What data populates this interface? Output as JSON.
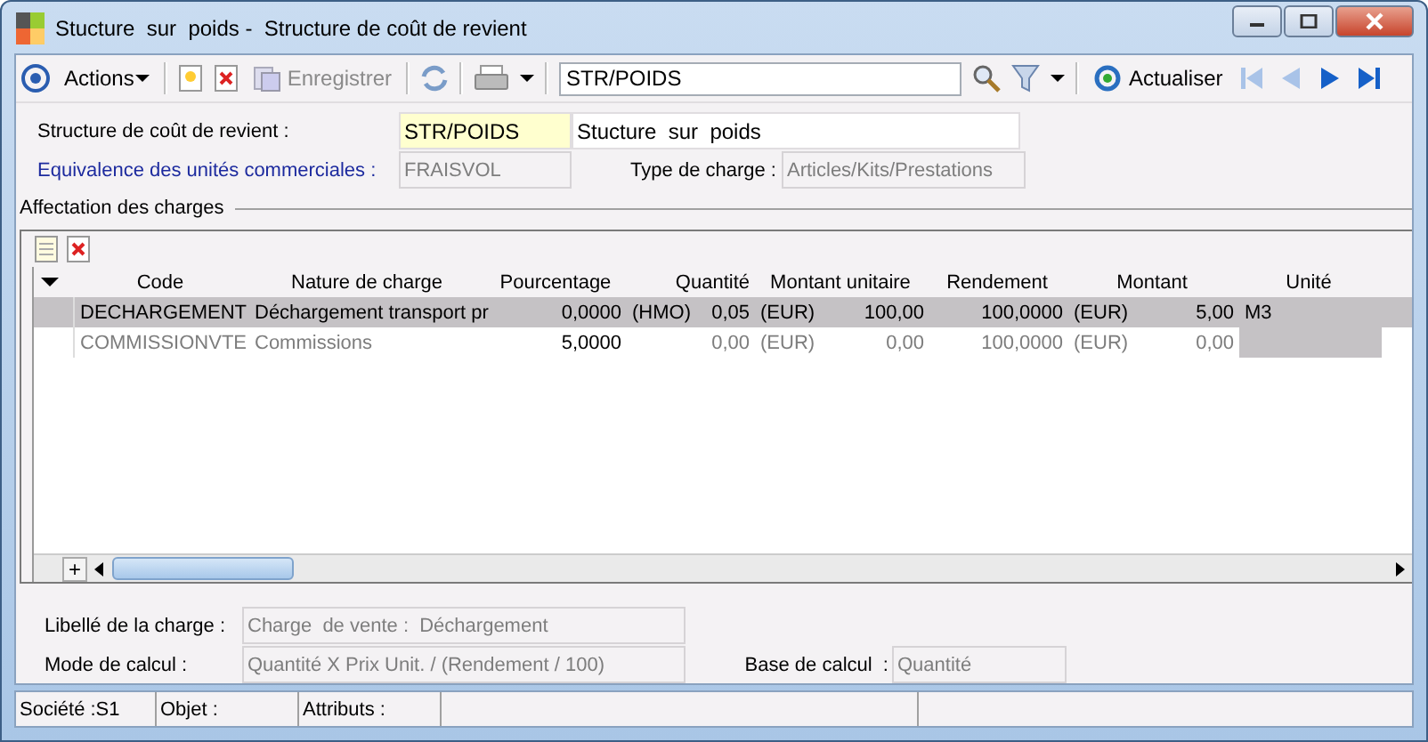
{
  "window": {
    "title": "Stucture  sur  poids -  Structure de coût de revient"
  },
  "toolbar": {
    "actions": "Actions",
    "save": {
      "label": "Enregistrer",
      "disabled": true
    },
    "search": {
      "value": "STR/POIDS"
    },
    "refresh": "Actualiser",
    "nav": [
      {
        "kind": "first",
        "disabled": true
      },
      {
        "kind": "prev",
        "disabled": true
      },
      {
        "kind": "next",
        "disabled": false
      },
      {
        "kind": "last",
        "disabled": false
      }
    ]
  },
  "header": {
    "structure_label": "Structure de coût de revient :",
    "structure_code": "STR/POIDS",
    "structure_name": "Stucture  sur  poids",
    "equivalence_label": "Equivalence des unités commerciales :",
    "equivalence_value": "FRAISVOL",
    "type_label": "Type de charge :",
    "type_value": "Articles/Kits/Prestations"
  },
  "charges": {
    "title": "Affectation des charges",
    "columns": [
      {
        "label": "Code"
      },
      {
        "label": "Nature de charge"
      },
      {
        "label": "Pourcentage",
        "editable": true
      },
      {
        "label": "Quantité"
      },
      {
        "label": "Montant unitaire"
      },
      {
        "label": "Rendement"
      },
      {
        "label": "Montant"
      },
      {
        "label": "Unité"
      }
    ],
    "add_row": "+",
    "rows": [
      {
        "selected": true,
        "disabled": false,
        "cells": [
          {
            "text": "DECHARGEMENT"
          },
          {
            "text": "Déchargement transport pr"
          },
          {
            "text": "0,0000"
          },
          {
            "unit": "(HMO)",
            "text": "0,05"
          },
          {
            "unit": "(EUR)",
            "text": "100,00"
          },
          {
            "text": "100,0000"
          },
          {
            "unit": "(EUR)",
            "text": "5,00"
          },
          {
            "text": "M3"
          }
        ]
      },
      {
        "selected": false,
        "disabled": true,
        "cells": [
          {
            "text": "COMMISSIONVTE"
          },
          {
            "text": "Commissions"
          },
          {
            "text": "5,0000"
          },
          {
            "text": "0,00"
          },
          {
            "unit": "(EUR)",
            "text": "0,00"
          },
          {
            "text": "100,0000"
          },
          {
            "unit": "(EUR)",
            "text": "0,00"
          }
        ]
      }
    ]
  },
  "details": {
    "libelle_label": "Libellé de la charge :",
    "libelle_value": "Charge  de vente :  Déchargement",
    "mode_label": "Mode de calcul :",
    "mode_value": "Quantité X Prix Unit. / (Rendement / 100)",
    "base_label": "Base de calcul  :",
    "base_value": "Quantité"
  },
  "status_bar": [
    "Société :S1",
    "Objet :",
    "Attributs :"
  ]
}
